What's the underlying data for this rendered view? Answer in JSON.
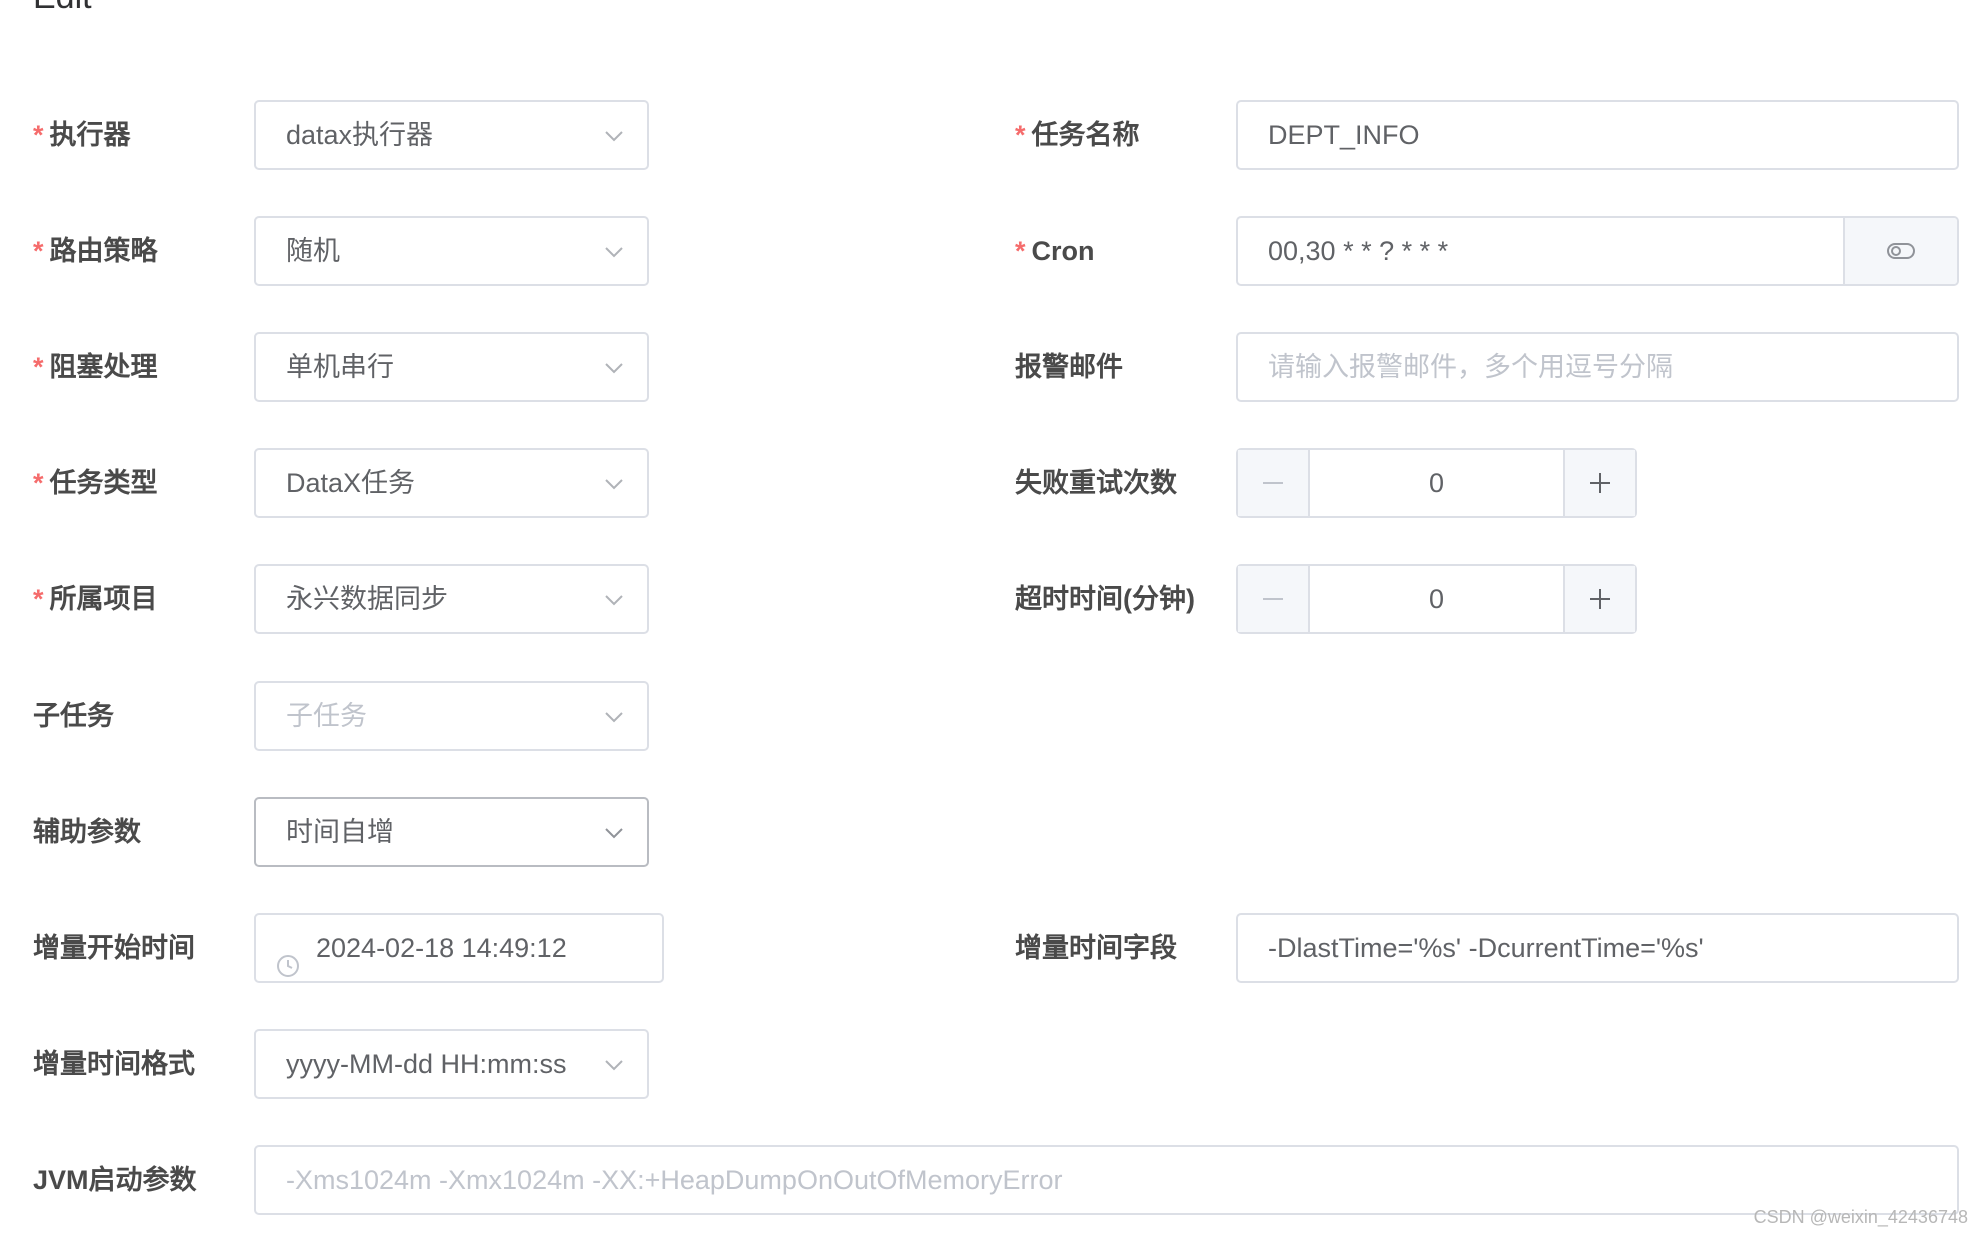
{
  "dialog": {
    "title": "Edit"
  },
  "form": {
    "executor": {
      "label": "执行器",
      "value": "datax执行器"
    },
    "task_name": {
      "label": "任务名称",
      "value": "DEPT_INFO"
    },
    "route_strategy": {
      "label": "路由策略",
      "value": "随机"
    },
    "cron": {
      "label": "Cron",
      "value": "00,30 * * ? * * *"
    },
    "block_strategy": {
      "label": "阻塞处理",
      "value": "单机串行"
    },
    "alarm_email": {
      "label": "报警邮件",
      "placeholder": "请输入报警邮件，多个用逗号分隔"
    },
    "task_type": {
      "label": "任务类型",
      "value": "DataX任务"
    },
    "fail_retry": {
      "label": "失败重试次数",
      "value": "0"
    },
    "project": {
      "label": "所属项目",
      "value": "永兴数据同步"
    },
    "timeout": {
      "label": "超时时间(分钟)",
      "value": "0"
    },
    "child_task": {
      "label": "子任务",
      "placeholder": "子任务"
    },
    "aux_param": {
      "label": "辅助参数",
      "value": "时间自增"
    },
    "incr_start_time": {
      "label": "增量开始时间",
      "value": "2024-02-18 14:49:12"
    },
    "incr_time_field": {
      "label": "增量时间字段",
      "value": "-DlastTime='%s' -DcurrentTime='%s'"
    },
    "incr_time_format": {
      "label": "增量时间格式",
      "value": "yyyy-MM-dd HH:mm:ss"
    },
    "jvm_params": {
      "label": "JVM启动参数",
      "placeholder": "-Xms1024m -Xmx1024m -XX:+HeapDumpOnOutOfMemoryError"
    }
  },
  "icons": {
    "select_arrow": "chevron-down-icon",
    "cron_toggle": "toggle-icon",
    "stepper_minus": "minus-icon",
    "stepper_plus": "plus-icon",
    "date_picker": "clock-icon"
  },
  "colors": {
    "required": "#f56c6c",
    "border": "#dcdfe6",
    "placeholder": "#c0c4cc"
  },
  "watermark": "CSDN @weixin_42436748"
}
